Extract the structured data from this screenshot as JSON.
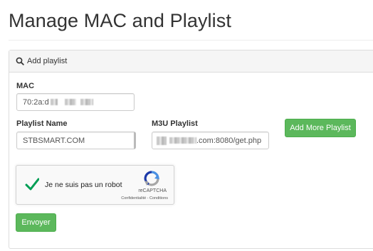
{
  "page": {
    "title": "Manage MAC and Playlist"
  },
  "panel": {
    "heading": "Add playlist",
    "heading_icon": "search-icon"
  },
  "mac": {
    "label": "MAC",
    "value_prefix": "70:2a:d"
  },
  "playlist_name": {
    "label": "Playlist Name",
    "value": "STBSMART.COM"
  },
  "m3u": {
    "label": "M3U Playlist",
    "value_suffix": ".com:8080/get.php"
  },
  "buttons": {
    "add_more": "Add More Playlist",
    "submit": "Envoyer"
  },
  "recaptcha": {
    "label": "Je ne suis pas un robot",
    "brand": "reCAPTCHA",
    "legal": "Confidentialité - Conditions",
    "checked": true
  },
  "colors": {
    "success": "#5cb85c",
    "check": "#009e55",
    "text": "#333333"
  }
}
